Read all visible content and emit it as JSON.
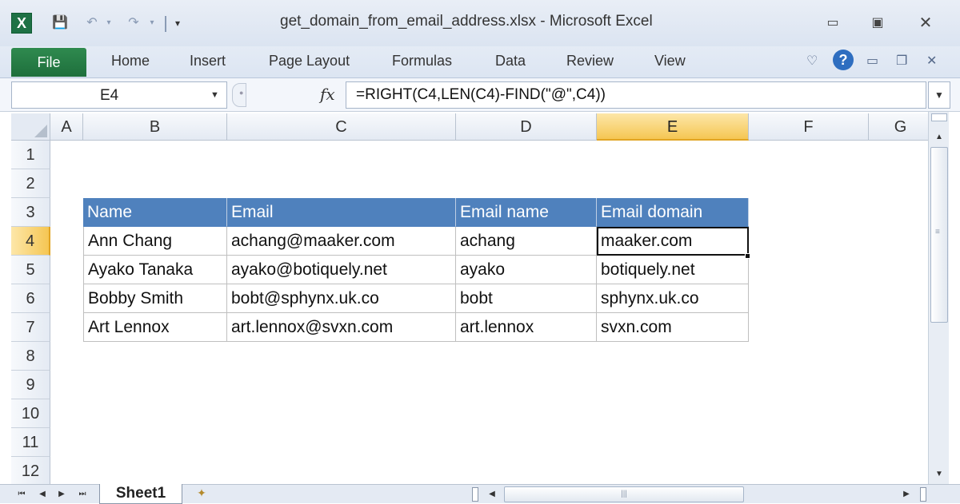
{
  "window": {
    "title": "get_domain_from_email_address.xlsx  -  Microsoft Excel",
    "app_icon": "X",
    "controls": {
      "minimize": "▭",
      "maximize": "▣",
      "close": "✕"
    }
  },
  "quick_access": {
    "save": "💾",
    "undo": "↶",
    "redo": "↷",
    "dropdown": "▾",
    "customize": "▾"
  },
  "ribbon": {
    "file_tab": "File",
    "tabs": [
      "Home",
      "Insert",
      "Page Layout",
      "Formulas",
      "Data",
      "Review",
      "View"
    ],
    "right_icons": {
      "minimize_ribbon": "♡",
      "help": "?",
      "win_min": "▭",
      "win_restore": "❐",
      "win_close": "✕"
    }
  },
  "formula_bar": {
    "name_box": "E4",
    "fx_label": "fx",
    "formula": "=RIGHT(C4,LEN(C4)-FIND(\"@\",C4))"
  },
  "sheet": {
    "columns": [
      "A",
      "B",
      "C",
      "D",
      "E",
      "F",
      "G"
    ],
    "active_column": "E",
    "rows": [
      "1",
      "2",
      "3",
      "4",
      "5",
      "6",
      "7",
      "8",
      "9",
      "10",
      "11",
      "12"
    ],
    "active_row": "4",
    "table": {
      "headers": [
        "Name",
        "Email",
        "Email name",
        "Email domain"
      ],
      "rows": [
        [
          "Ann Chang",
          "achang@maaker.com",
          "achang",
          "maaker.com"
        ],
        [
          "Ayako Tanaka",
          "ayako@botiquely.net",
          "ayako",
          "botiquely.net"
        ],
        [
          "Bobby Smith",
          "bobt@sphynx.uk.co",
          "bobt",
          "sphynx.uk.co"
        ],
        [
          "Art Lennox",
          "art.lennox@svxn.com",
          "art.lennox",
          "svxn.com"
        ]
      ]
    },
    "selected_cell": "E4",
    "header_color": "#4f81bd"
  },
  "sheet_tabs": {
    "active": "Sheet1",
    "nav": [
      "⏮",
      "◀",
      "▶",
      "⏭"
    ]
  },
  "scrollbars": {
    "grip": "≡",
    "hgrip": "|||"
  }
}
